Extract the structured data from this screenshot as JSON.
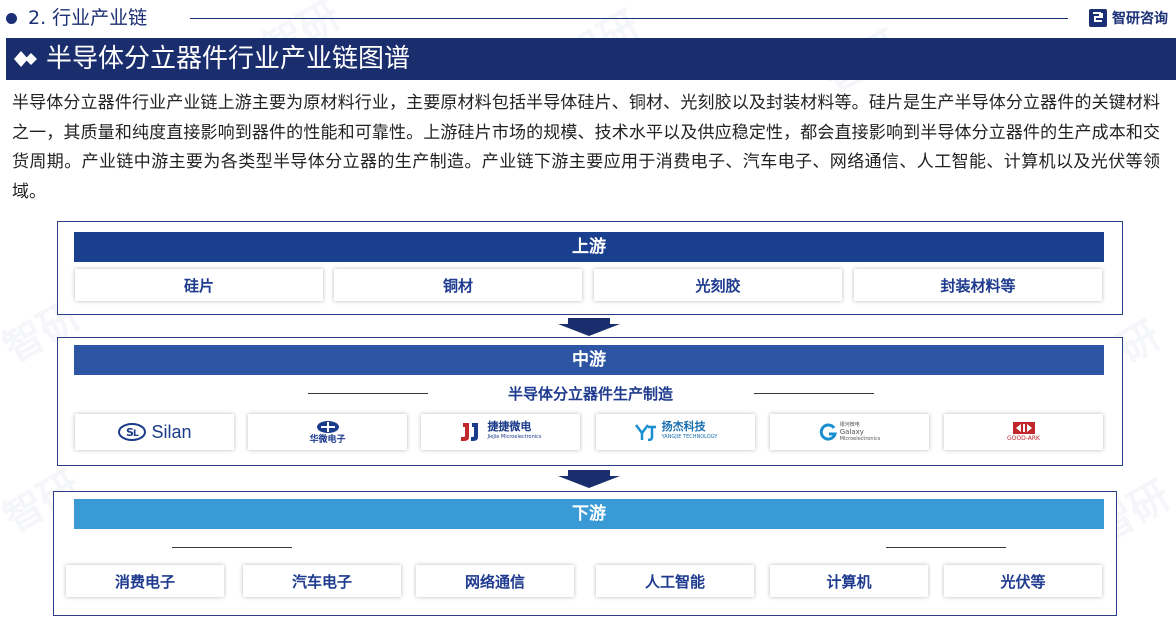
{
  "header": {
    "section_label": "2. 行业产业链",
    "brand_name": "智研咨询"
  },
  "title": "半导体分立器件行业产业链图谱",
  "intro": "半导体分立器件行业产业链上游主要为原材料行业，主要原材料包括半导体硅片、铜材、光刻胶以及封装材料等。硅片是生产半导体分立器件的关键材料之一，其质量和纯度直接影响到器件的性能和可靠性。上游硅片市场的规模、技术水平以及供应稳定性，都会直接影响到半导体分立器件的生产成本和交货周期。产业链中游主要为各类型半导体分立器的生产制造。产业链下游主要应用于消费电子、汽车电子、网络通信、人工智能、计算机以及光伏等领域。",
  "upstream": {
    "label": "上游",
    "items": [
      "硅片",
      "铜材",
      "光刻胶",
      "封装材料等"
    ]
  },
  "midstream": {
    "label": "中游",
    "sublabel": "半导体分立器件生产制造",
    "logos": [
      {
        "name": "Silan",
        "text": "Silan"
      },
      {
        "name": "Huawei Electronics",
        "text": "华微电子"
      },
      {
        "name": "JieJie Microelectronics",
        "text": "捷捷微电",
        "subtext": "JieJie Microelectronics"
      },
      {
        "name": "Yangjie Technology",
        "text": "扬杰科技",
        "subtext": "YANGJIE TECHNOLOGY"
      },
      {
        "name": "Galaxy Microelectronics",
        "text": "Galaxy",
        "subtext": "Microelectronics",
        "cn": "银河微电"
      },
      {
        "name": "Good-Ark",
        "text": "GOOD-ARK"
      }
    ]
  },
  "downstream": {
    "label": "下游",
    "items": [
      "消费电子",
      "汽车电子",
      "网络通信",
      "人工智能",
      "计算机",
      "光伏等"
    ]
  },
  "colors": {
    "navy": "#1a2d6c",
    "upstream_band": "#1a3f8f",
    "midstream_band": "#2d55a3",
    "downstream_band": "#3a9ad6",
    "cell_text": "#1f3b8f"
  }
}
